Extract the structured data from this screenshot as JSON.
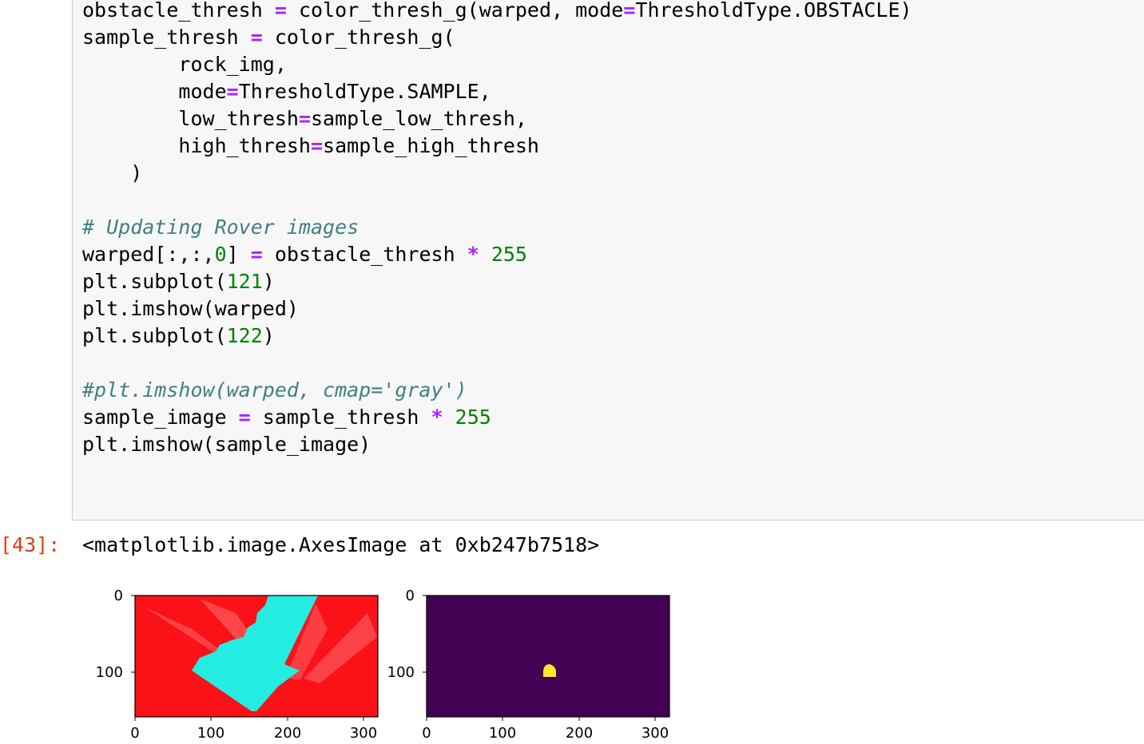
{
  "cell": {
    "code_lines": [
      "obstacle_thresh = color_thresh_g(warped, mode=ThresholdType.OBSTACLE)",
      "sample_thresh = color_thresh_g(",
      "        rock_img,",
      "        mode=ThresholdType.SAMPLE,",
      "        low_thresh=sample_low_thresh,",
      "        high_thresh=sample_high_thresh",
      "    )",
      "",
      "# Updating Rover images",
      "warped[:,:,0] = obstacle_thresh * 255",
      "plt.subplot(121)",
      "plt.imshow(warped)",
      "plt.subplot(122)",
      "",
      "#plt.imshow(warped, cmap='gray')",
      "sample_image = sample_thresh * 255",
      "plt.imshow(sample_image)"
    ]
  },
  "output": {
    "prompt": "[43]:",
    "text": "<matplotlib.image.AxesImage at 0xb247b7518>"
  },
  "plots": [
    {
      "name": "warped",
      "y_ticks": [
        "0",
        "100"
      ],
      "x_ticks": [
        "0",
        "100",
        "200",
        "300"
      ],
      "colors": {
        "background": "#fb1118",
        "terrain": "#25ece0"
      }
    },
    {
      "name": "sample_image",
      "y_ticks": [
        "0",
        "100"
      ],
      "x_ticks": [
        "0",
        "100",
        "200",
        "300"
      ],
      "colors": {
        "background": "#440154",
        "sample": "#fde725"
      }
    }
  ]
}
